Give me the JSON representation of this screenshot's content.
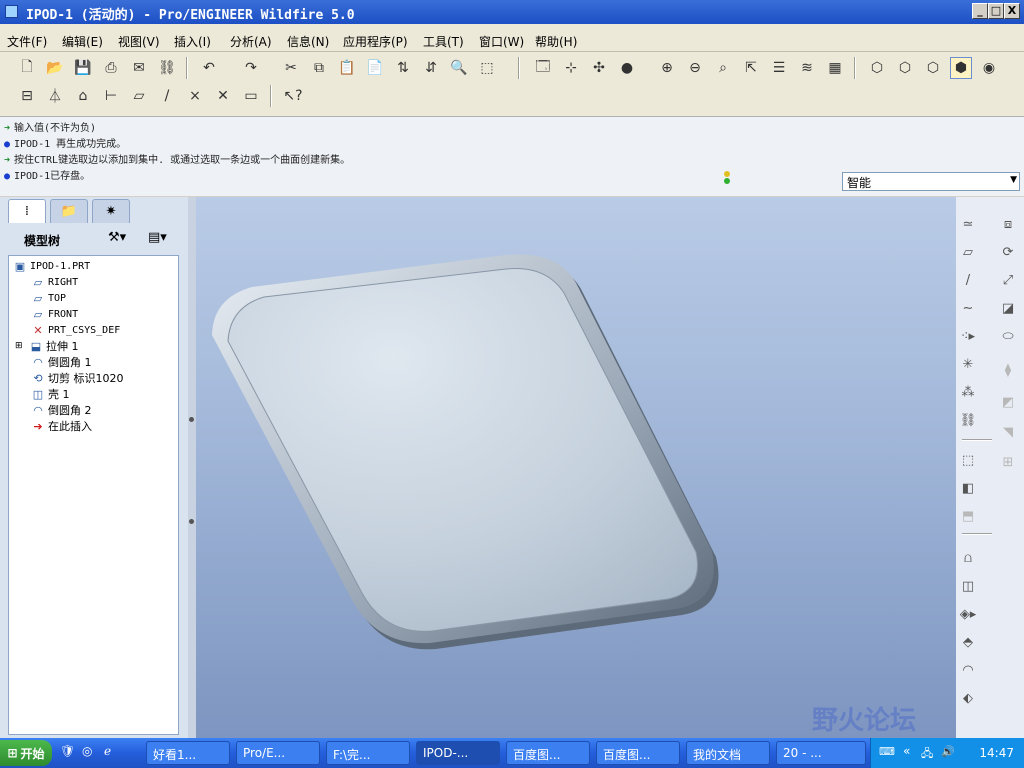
{
  "window": {
    "title": "IPOD-1 (活动的) - Pro/ENGINEER Wildfire 5.0",
    "buttons": {
      "minimize": "_",
      "maximize": "□",
      "close": "X"
    }
  },
  "menubar": {
    "items": [
      "文件(F)",
      "编辑(E)",
      "视图(V)",
      "插入(I)",
      "分析(A)",
      "信息(N)",
      "应用程序(P)",
      "工具(T)",
      "窗口(W)",
      "帮助(H)"
    ]
  },
  "messages": [
    {
      "kind": "prompt",
      "text": "输入值(不许为负)"
    },
    {
      "kind": "info",
      "text": "IPOD-1 再生成功完成。"
    },
    {
      "kind": "prompt",
      "text": "按住CTRL键选取边以添加到集中. 或通过选取一条边或一个曲面创建新集。"
    },
    {
      "kind": "info",
      "text": "IPOD-1已存盘。"
    }
  ],
  "filter": {
    "value": "智能"
  },
  "model_tree": {
    "title": "模型树",
    "nodes": [
      {
        "label": "IPOD-1.PRT",
        "icon": "part-icon",
        "level": 0
      },
      {
        "label": "RIGHT",
        "icon": "datum-plane-icon",
        "level": 1
      },
      {
        "label": "TOP",
        "icon": "datum-plane-icon",
        "level": 1
      },
      {
        "label": "FRONT",
        "icon": "datum-plane-icon",
        "level": 1
      },
      {
        "label": "PRT_CSYS_DEF",
        "icon": "csys-icon",
        "level": 1
      },
      {
        "label": "拉伸 1",
        "icon": "extrude-icon",
        "level": 1,
        "expandable": true
      },
      {
        "label": "倒圆角 1",
        "icon": "round-icon",
        "level": 1
      },
      {
        "label": "切剪 标识1020",
        "icon": "cut-icon",
        "level": 1
      },
      {
        "label": "壳 1",
        "icon": "shell-icon",
        "level": 1
      },
      {
        "label": "倒圆角 2",
        "icon": "round-icon",
        "level": 1
      },
      {
        "label": "在此插入",
        "icon": "insert-here-arrow-icon",
        "level": 1
      }
    ]
  },
  "taskbar": {
    "start": "开始",
    "tasks": [
      "好看1...",
      "Pro/E...",
      "F:\\完...",
      "IPOD-...",
      "百度图...",
      "百度图...",
      "我的文档",
      "20 - ..."
    ],
    "clock": "14:47"
  },
  "watermark": "野火论坛",
  "colors": {
    "titlebar": "#1c4fc4",
    "graphics_top": "#b9cbe6",
    "graphics_bottom": "#7d95c0",
    "model": "#c9d4de"
  }
}
